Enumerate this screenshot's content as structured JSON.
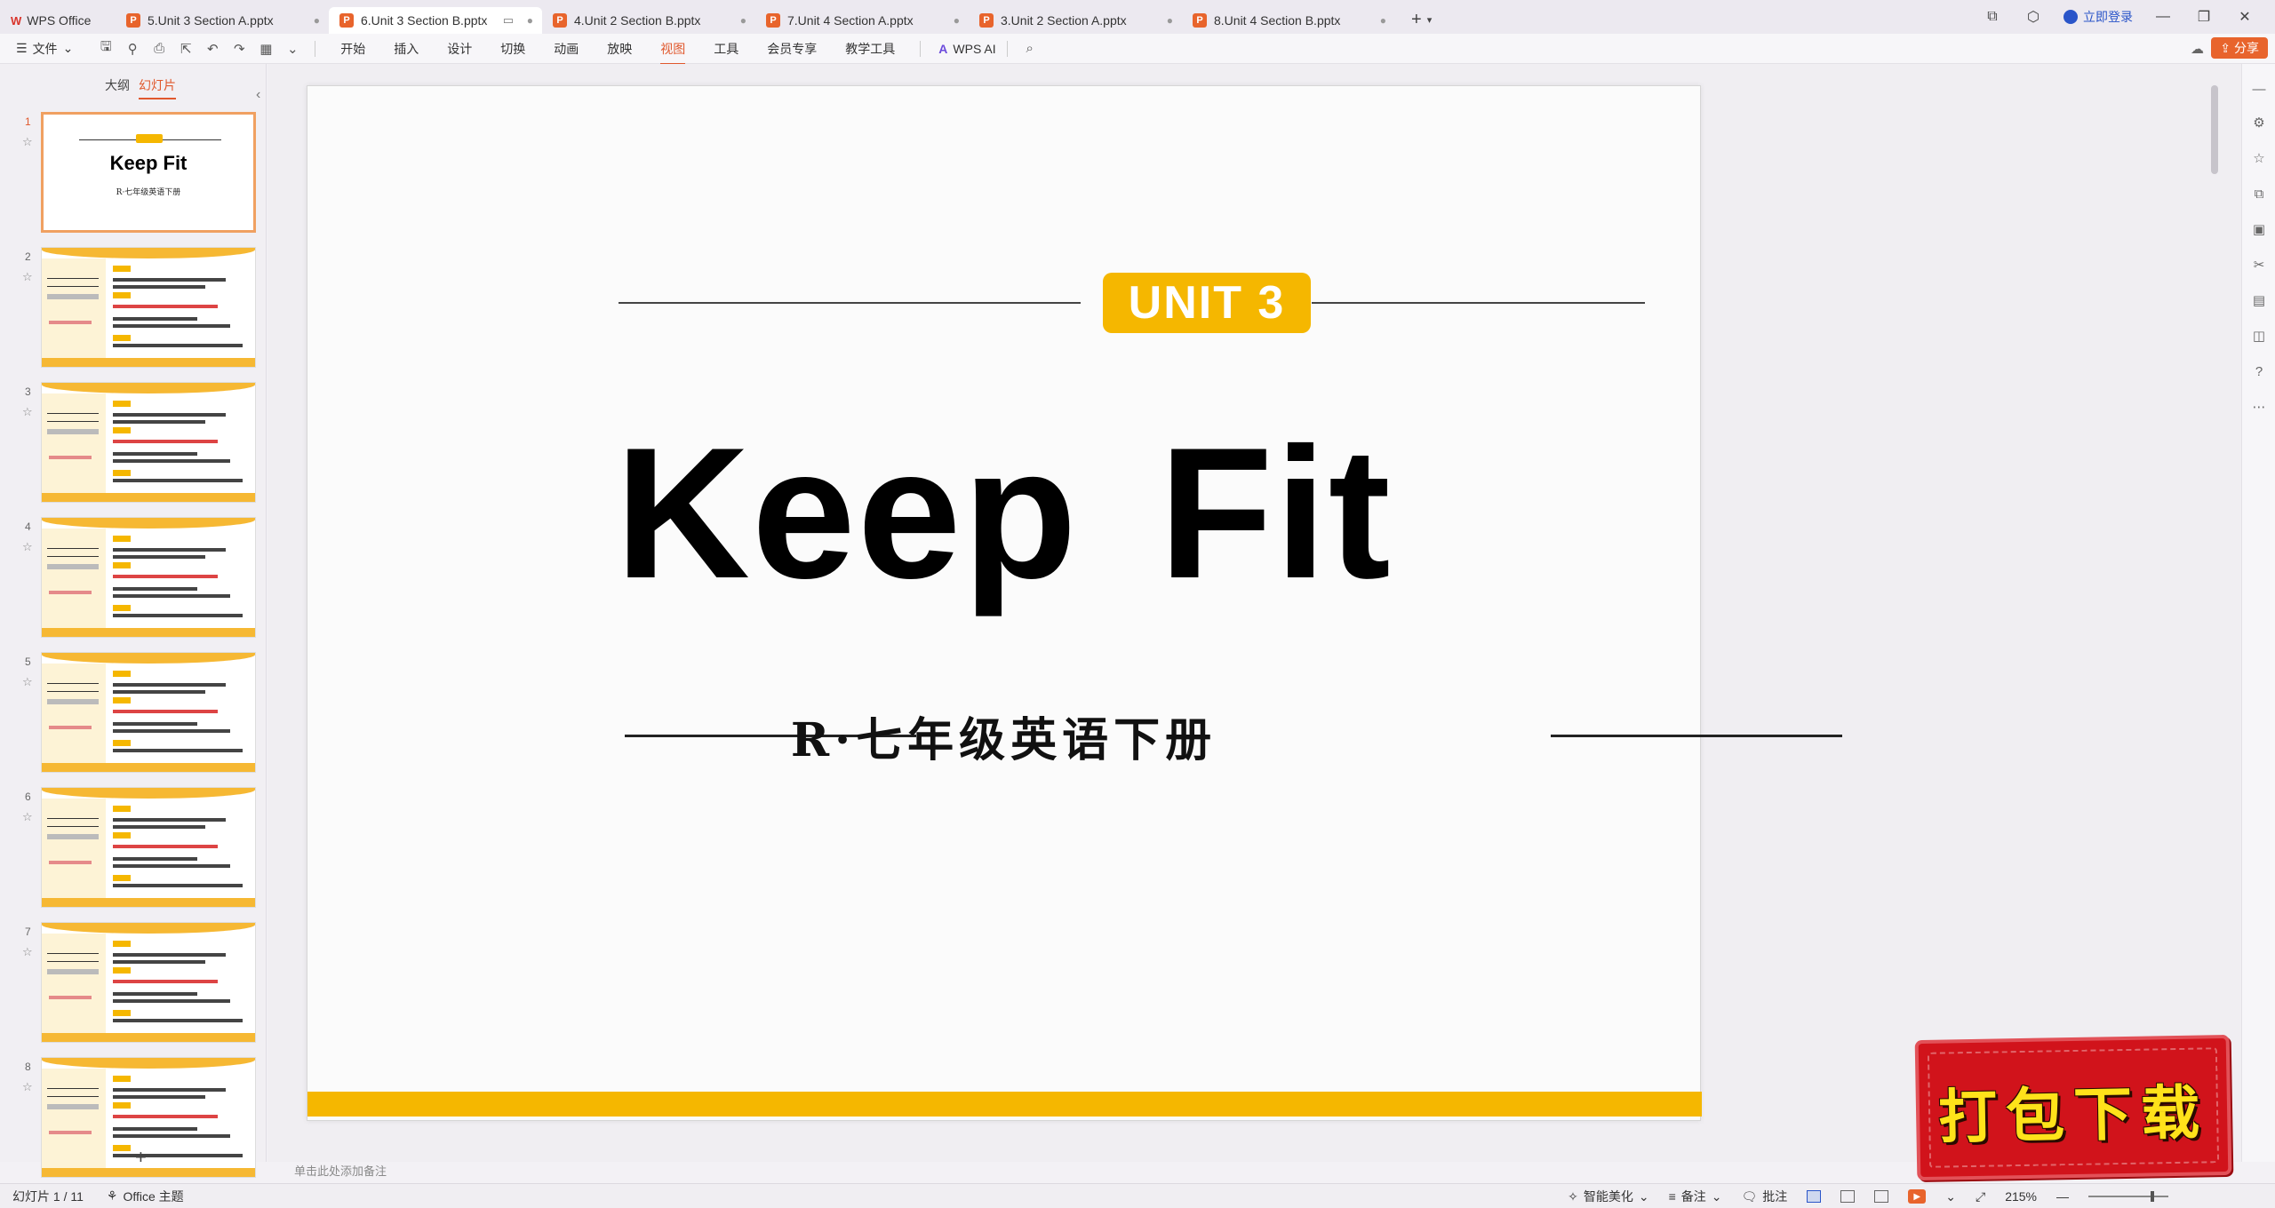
{
  "tabs": [
    {
      "label": "WPS Office",
      "type": "home",
      "active": false
    },
    {
      "label": "5.Unit 3 Section A.pptx",
      "type": "doc",
      "active": false
    },
    {
      "label": "6.Unit 3 Section B.pptx",
      "type": "doc",
      "active": true
    },
    {
      "label": "4.Unit 2 Section B.pptx",
      "type": "doc",
      "active": false
    },
    {
      "label": "7.Unit 4 Section A.pptx",
      "type": "doc",
      "active": false
    },
    {
      "label": "3.Unit 2 Section A.pptx",
      "type": "doc",
      "active": false
    },
    {
      "label": "8.Unit 4 Section B.pptx",
      "type": "doc",
      "active": false
    }
  ],
  "titlebar": {
    "add_tab": "+",
    "login_label": "立即登录"
  },
  "toolbar": {
    "file_label": "文件",
    "menus": [
      "开始",
      "插入",
      "设计",
      "切换",
      "动画",
      "放映",
      "视图",
      "工具",
      "会员专享",
      "教学工具"
    ],
    "active_menu": "视图",
    "ai_label": "WPS AI",
    "share_label": "分享"
  },
  "left_panel": {
    "tab_outline": "大纲",
    "tab_slides": "幻灯片",
    "add_slide": "+",
    "thumbs": [
      {
        "num": "1",
        "type": "title"
      },
      {
        "num": "2",
        "type": "vocab"
      },
      {
        "num": "3",
        "type": "vocab"
      },
      {
        "num": "4",
        "type": "vocab"
      },
      {
        "num": "5",
        "type": "vocab"
      },
      {
        "num": "6",
        "type": "vocab"
      },
      {
        "num": "7",
        "type": "vocab"
      },
      {
        "num": "8",
        "type": "vocab"
      }
    ],
    "thumb1_title": "Keep  Fit",
    "thumb1_sub": "R·七年级英语下册"
  },
  "slide": {
    "unit": "UNIT 3",
    "title": "Keep  Fit",
    "subtitle": "R·七年级英语下册",
    "accent": "#f5b700"
  },
  "notes": {
    "placeholder": "单击此处添加备注"
  },
  "status": {
    "slide_counter": "幻灯片 1 / 11",
    "theme": "Office 主题",
    "beautify": "智能美化",
    "notes": "备注",
    "comments": "批注",
    "zoom": "215%"
  },
  "stamp": {
    "text": "打包下载"
  }
}
